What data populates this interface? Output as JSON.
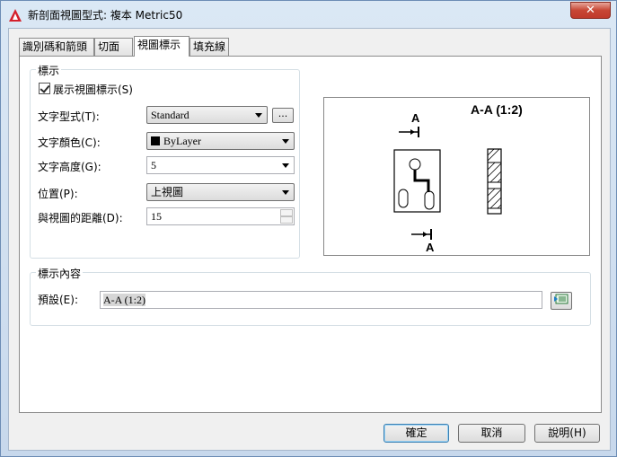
{
  "window": {
    "title": "新剖面視圖型式: 複本 Metric50",
    "close_glyph": "✕"
  },
  "tabs": [
    {
      "label": "識別碼和箭頭",
      "active": false
    },
    {
      "label": "切面",
      "active": false
    },
    {
      "label": "視圖標示",
      "active": true
    },
    {
      "label": "填充線",
      "active": false
    }
  ],
  "label_group": {
    "title": "標示",
    "show_label": {
      "label": "展示視圖標示(S)",
      "checked": true
    },
    "text_style": {
      "label": "文字型式(T):",
      "value": "Standard",
      "browse": "..."
    },
    "text_color": {
      "label": "文字顏色(C):",
      "value": "ByLayer",
      "swatch_color": "#000000"
    },
    "text_height": {
      "label": "文字高度(G):",
      "value": "5"
    },
    "position": {
      "label": "位置(P):",
      "value": "上視圖"
    },
    "distance": {
      "label": "與視圖的距離(D):",
      "value": "15"
    }
  },
  "preview": {
    "title": "A-A (1:2)",
    "top_letter": "A",
    "bottom_letter": "A"
  },
  "content_group": {
    "title": "標示內容",
    "default_label": "預設(E):",
    "default_value": "A-A (1:2)"
  },
  "buttons": {
    "ok": "確定",
    "cancel": "取消",
    "help": "說明(H)"
  }
}
